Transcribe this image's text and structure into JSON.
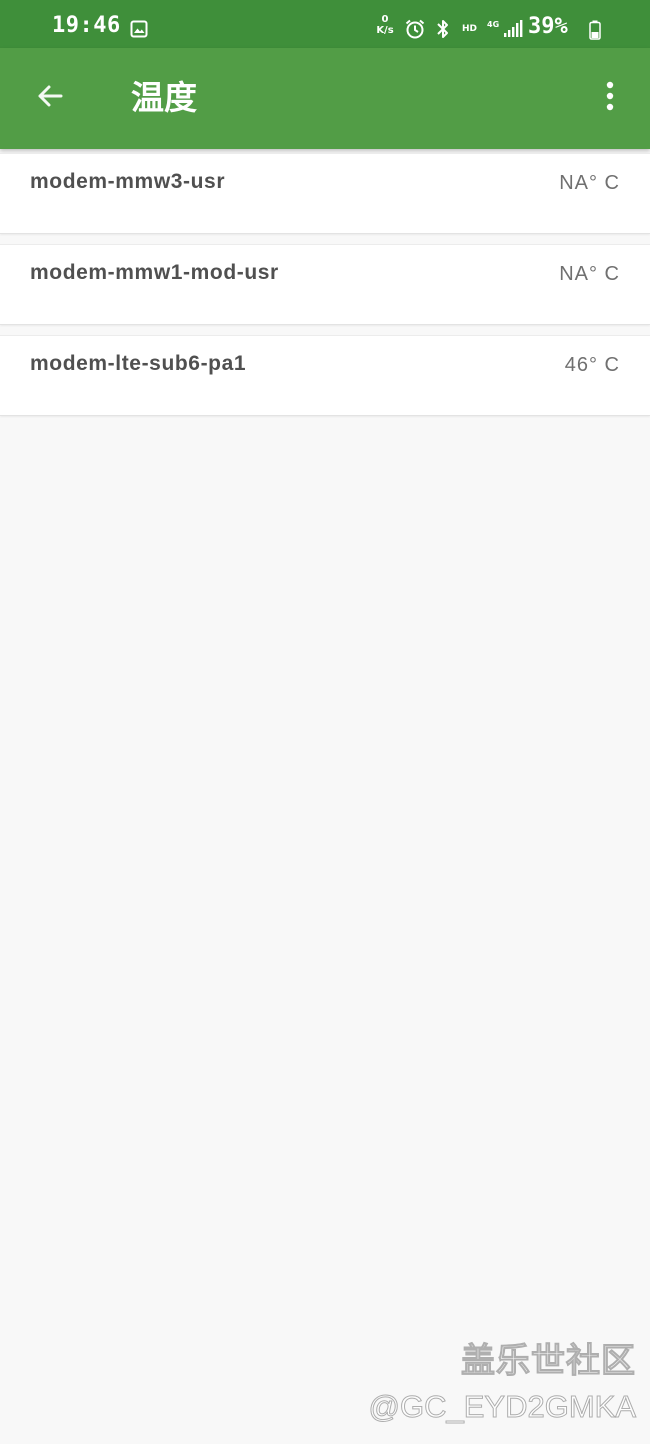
{
  "status_bar": {
    "time": "19:46",
    "net_speed_value": "0",
    "net_speed_unit": "K/s",
    "hd_label": "HD",
    "network_type": "4G",
    "battery_percent": "39%",
    "icons": [
      "gallery-icon",
      "alarm-icon",
      "bluetooth-icon",
      "signal-icon",
      "battery-icon"
    ]
  },
  "app_bar": {
    "title": "温度",
    "back_icon": "arrow-left-icon",
    "menu_icon": "more-vert-icon"
  },
  "sensors": [
    {
      "name": "modem-mmw3-usr",
      "value": "NA° C"
    },
    {
      "name": "modem-mmw1-mod-usr",
      "value": "NA° C"
    },
    {
      "name": "modem-lte-sub6-pa1",
      "value": "46° C"
    }
  ],
  "watermark": {
    "title": "盖乐世社区",
    "user": "@GC_EYD2GMKA"
  },
  "colors": {
    "status_bar": "#3f8f3a",
    "app_bar": "#529d46",
    "background": "#f8f8f8",
    "card": "#ffffff"
  }
}
